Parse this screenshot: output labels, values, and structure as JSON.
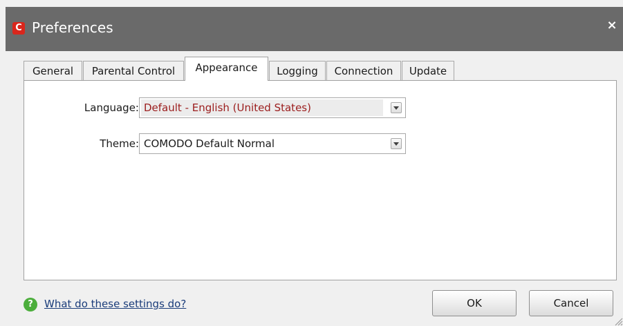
{
  "window": {
    "title": "Preferences",
    "app_icon_letter": "C",
    "close_symbol": "×",
    "colors": {
      "titlebar": "#6a6a6a",
      "app_icon": "#d9261c",
      "language_value_text": "#9b1c1c",
      "help_icon": "#4cae3c"
    }
  },
  "tabs": [
    {
      "label": "General",
      "active": false
    },
    {
      "label": "Parental Control",
      "active": false
    },
    {
      "label": "Appearance",
      "active": true
    },
    {
      "label": "Logging",
      "active": false
    },
    {
      "label": "Connection",
      "active": false
    },
    {
      "label": "Update",
      "active": false
    }
  ],
  "appearance": {
    "language": {
      "label": "Language:",
      "value": "Default - English (United States)"
    },
    "theme": {
      "label": "Theme:",
      "value": "COMODO Default Normal"
    }
  },
  "footer": {
    "help_icon_symbol": "?",
    "help_link": "What do these settings do?",
    "ok_label": "OK",
    "cancel_label": "Cancel"
  }
}
